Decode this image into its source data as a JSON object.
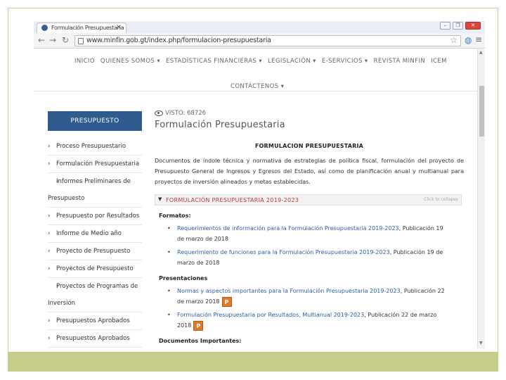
{
  "browser": {
    "tab_title": "Formulación Presupuestaria",
    "url": "www.minfin.gob.gt/index.php/formulacion-presupuestaria"
  },
  "nav": {
    "items": [
      "INICIO",
      "QUIENES SOMOS ▾",
      "ESTADÍSTICAS FINANCIERAS ▾",
      "LEGISLACIÓN ▾",
      "E-SERVICIOS ▾",
      "REVISTA MINFIN",
      "ICEM"
    ],
    "contact": "CONTÁCTENOS ▾"
  },
  "sidebar": {
    "header": "PRESUPUESTO",
    "items": [
      "Proceso Presupuestario",
      "Formulación Presupuestaria",
      "Informes Preliminares de Presupuesto",
      "Presupuesto por Resultados",
      "Informe de Medio año",
      "Proyecto de Presupuesto",
      "Proyectos de Presupuesto",
      "Proyectos de Programas de Inversión",
      "Presupuestos Aprobados",
      "Presupuestos Aprobados"
    ]
  },
  "main": {
    "views": "VISTO: 68726",
    "title": "Formulación Presupuestaria",
    "doc_title": "FORMULACION PRESUPUESTARIA",
    "description": "Documentos de índole técnica y normativa de estrategias de política fiscal, formulación del proyecto de Presupuesto General de Ingresos y Egresos del Estado, así como de planificación anual y multianual para proyectos de inversión alineados y metas establecidas.",
    "accordion_label": "FORMULACIÓN PRESUPUESTARIA 2019-2023",
    "accordion_hint": "Click to collapse",
    "sections": [
      {
        "label": "Formatos:",
        "items": [
          {
            "text": "Requerimientos de información para la Formulación Presupuestaria 2019-2023",
            "meta": ", Publicación 19 de marzo de 2018",
            "ppt": false
          },
          {
            "text": "Requerimiento de funciones para la Formulación Presupuestaria 2019-2023",
            "meta": ", Publicación 19 de marzo de 2018",
            "ppt": false
          }
        ]
      },
      {
        "label": "Presentaciones",
        "items": [
          {
            "text": "Normas y aspectos importantes para la Formulación Presupuestaria 2019-2023",
            "meta": ", Publicación 22 de marzo 2018",
            "ppt": true
          },
          {
            "text": "Formulación Presupuestaria por Resultados, Multianual 2019-2023",
            "meta": ", Publicación 22 de marzo 2018",
            "ppt": true
          }
        ]
      },
      {
        "label": "Documentos Importantes:",
        "items": []
      }
    ]
  },
  "icons": {
    "ppt_glyph": "P",
    "star": "☆",
    "menu": "≡"
  }
}
